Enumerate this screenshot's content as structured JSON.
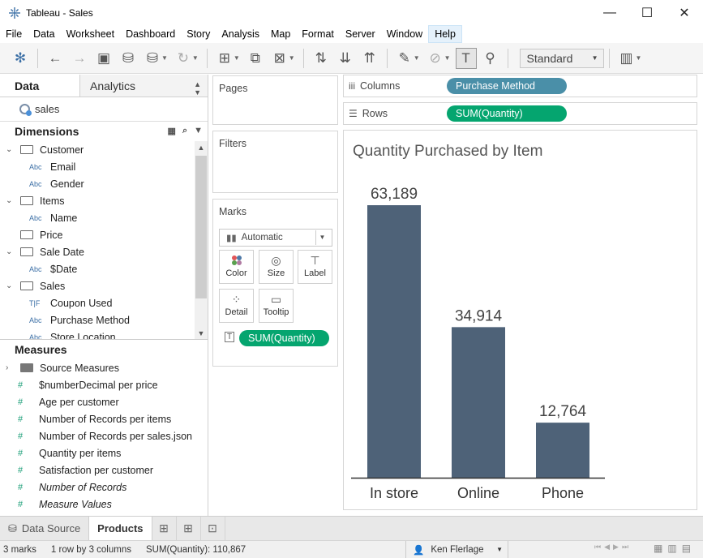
{
  "window": {
    "title": "Tableau - Sales",
    "controls": {
      "minimize": "—",
      "maximize": "☐",
      "close": "✕"
    }
  },
  "menu": [
    "File",
    "Data",
    "Worksheet",
    "Dashboard",
    "Story",
    "Analysis",
    "Map",
    "Format",
    "Server",
    "Window",
    "Help"
  ],
  "toolbar": {
    "fit_select": "Standard",
    "icons": [
      "tableau-logo-icon",
      "undo-icon",
      "redo-icon",
      "save-icon",
      "new-datasource-icon",
      "pause-updates-icon",
      "refresh-icon",
      "new-worksheet-icon",
      "duplicate-icon",
      "clear-sheet-icon",
      "swap-icon",
      "sort-ascending-icon",
      "sort-descending-icon",
      "highlight-icon",
      "group-icon",
      "show-labels-icon",
      "pin-icon",
      "show-me-icon"
    ]
  },
  "data_pane": {
    "tab_data": "Data",
    "tab_analytics": "Analytics",
    "datasource": "sales",
    "dimensions_label": "Dimensions",
    "dimensions": [
      {
        "kind": "folder",
        "label": "Customer"
      },
      {
        "kind": "field",
        "type": "Abc",
        "label": "Email"
      },
      {
        "kind": "field",
        "type": "Abc",
        "label": "Gender"
      },
      {
        "kind": "folder",
        "label": "Items"
      },
      {
        "kind": "field",
        "type": "Abc",
        "label": "Name"
      },
      {
        "kind": "folder-collapsed",
        "label": "Price"
      },
      {
        "kind": "folder",
        "label": "Sale Date"
      },
      {
        "kind": "field",
        "type": "Abc",
        "label": "$Date"
      },
      {
        "kind": "folder",
        "label": "Sales"
      },
      {
        "kind": "field",
        "type": "T|F",
        "label": "Coupon Used"
      },
      {
        "kind": "field",
        "type": "Abc",
        "label": "Purchase Method"
      },
      {
        "kind": "field",
        "type": "Abc",
        "label": "Store Location"
      }
    ],
    "measures_label": "Measures",
    "measures": [
      {
        "kind": "folder-filled",
        "label": "Source Measures",
        "italic": false
      },
      {
        "kind": "measure",
        "label": "$numberDecimal per price",
        "italic": false
      },
      {
        "kind": "measure",
        "label": "Age per customer",
        "italic": false
      },
      {
        "kind": "measure",
        "label": "Number of Records per items",
        "italic": false
      },
      {
        "kind": "measure",
        "label": "Number of Records per sales.json",
        "italic": false
      },
      {
        "kind": "measure",
        "label": "Quantity per items",
        "italic": false
      },
      {
        "kind": "measure",
        "label": "Satisfaction per customer",
        "italic": false
      },
      {
        "kind": "measure",
        "label": "Number of Records",
        "italic": true
      },
      {
        "kind": "measure",
        "label": "Measure Values",
        "italic": true
      }
    ]
  },
  "cards": {
    "pages": "Pages",
    "filters": "Filters",
    "marks": "Marks",
    "mark_type": "Automatic",
    "buttons": {
      "color": "Color",
      "size": "Size",
      "label": "Label",
      "detail": "Detail",
      "tooltip": "Tooltip"
    },
    "label_pill": "SUM(Quantity)"
  },
  "shelves": {
    "columns_label": "Columns",
    "columns_pill": "Purchase Method",
    "rows_label": "Rows",
    "rows_pill": "SUM(Quantity)"
  },
  "chart_data": {
    "type": "bar",
    "title": "Quantity Purchased by Item",
    "categories": [
      "In store",
      "Online",
      "Phone"
    ],
    "values": [
      63189,
      34914,
      12764
    ],
    "value_labels": [
      "63,189",
      "34,914",
      "12,764"
    ],
    "xlabel": "",
    "ylabel": "",
    "ylim": [
      0,
      66000
    ],
    "bar_color": "#4e6278",
    "grid": false
  },
  "bottom_tabs": {
    "datasource": "Data Source",
    "sheet": "Products"
  },
  "status": {
    "marks": "3 marks",
    "dims": "1 row by 3 columns",
    "sum": "SUM(Quantity): 110,867",
    "user": "Ken Flerlage"
  }
}
